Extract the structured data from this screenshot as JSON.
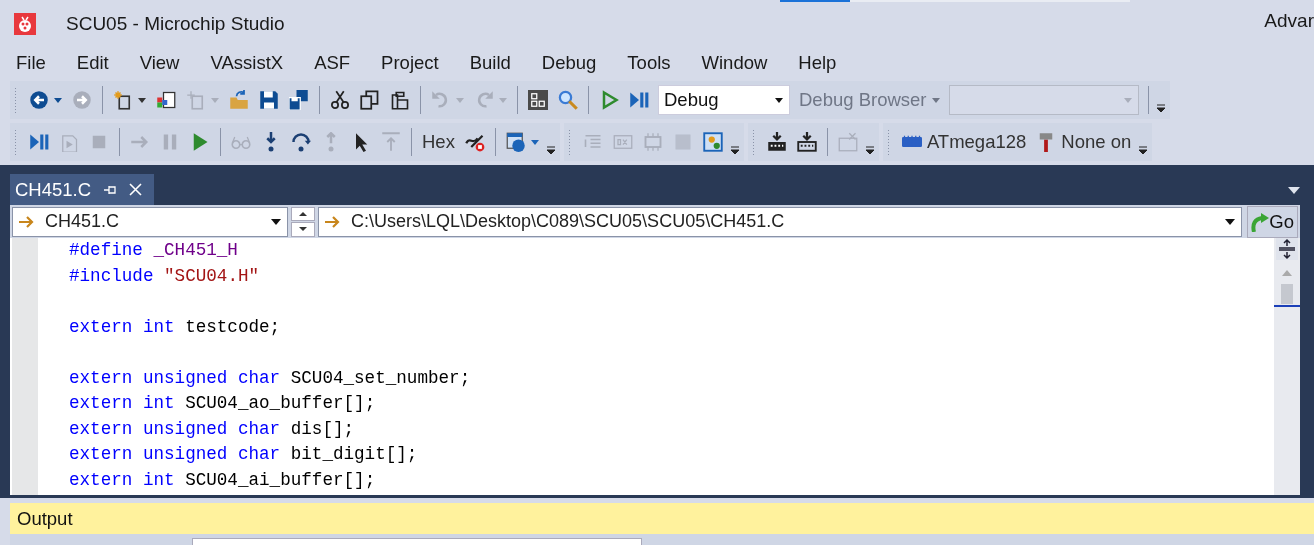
{
  "window": {
    "title": "SCU05 - Microchip Studio",
    "title_right": "Advar"
  },
  "menu": [
    "File",
    "Edit",
    "View",
    "VAssistX",
    "ASF",
    "Project",
    "Build",
    "Debug",
    "Tools",
    "Window",
    "Help"
  ],
  "toolbars": [
    {
      "groups": [
        {
          "items": [
            {
              "kind": "button",
              "disabled": false,
              "dropdown": true
            },
            {
              "kind": "button",
              "disabled": true,
              "dropdown": false
            },
            {
              "kind": "separator"
            },
            {
              "kind": "button",
              "disabled": false,
              "dropdown": true
            },
            {
              "kind": "button",
              "disabled": false,
              "dropdown": false
            },
            {
              "kind": "button",
              "disabled": true,
              "dropdown": true
            },
            {
              "kind": "button",
              "disabled": false,
              "dropdown": false
            },
            {
              "kind": "button",
              "disabled": false,
              "dropdown": false
            },
            {
              "kind": "button",
              "disabled": false,
              "dropdown": false
            },
            {
              "kind": "separator"
            },
            {
              "kind": "button",
              "disabled": false,
              "dropdown": false
            },
            {
              "kind": "button",
              "disabled": false,
              "dropdown": false
            },
            {
              "kind": "button",
              "disabled": false,
              "dropdown": false
            },
            {
              "kind": "separator"
            },
            {
              "kind": "button",
              "disabled": true,
              "dropdown": true
            },
            {
              "kind": "button",
              "disabled": true,
              "dropdown": true
            },
            {
              "kind": "separator"
            },
            {
              "kind": "button",
              "disabled": false,
              "dropdown": false
            },
            {
              "kind": "button",
              "disabled": false,
              "dropdown": false
            },
            {
              "kind": "separator"
            },
            {
              "kind": "button",
              "disabled": false,
              "dropdown": false
            },
            {
              "kind": "button",
              "disabled": false,
              "dropdown": false
            },
            {
              "kind": "combo",
              "value": "Debug",
              "disabled": false
            },
            {
              "kind": "text_button",
              "label": "Debug Browser",
              "disabled": true,
              "dropdown": true
            },
            {
              "kind": "combo",
              "disabled": true
            },
            {
              "kind": "separator"
            }
          ]
        }
      ]
    },
    {
      "groups": [
        {
          "items": [
            {
              "kind": "button",
              "disabled": false,
              "dropdown": false
            },
            {
              "kind": "button",
              "disabled": true,
              "dropdown": false
            },
            {
              "kind": "button",
              "disabled": true,
              "dropdown": false
            },
            {
              "kind": "separator"
            },
            {
              "kind": "button",
              "disabled": true,
              "dropdown": false
            },
            {
              "kind": "button",
              "disabled": true,
              "dropdown": false
            },
            {
              "kind": "button",
              "disabled": false,
              "dropdown": false
            },
            {
              "kind": "separator"
            },
            {
              "kind": "button",
              "disabled": true,
              "dropdown": false
            },
            {
              "kind": "button",
              "disabled": false,
              "dropdown": false
            },
            {
              "kind": "button",
              "disabled": false,
              "dropdown": false
            },
            {
              "kind": "button",
              "disabled": true,
              "dropdown": false
            },
            {
              "kind": "button",
              "disabled": false,
              "dropdown": false
            },
            {
              "kind": "button",
              "disabled": true,
              "dropdown": false
            },
            {
              "kind": "separator"
            },
            {
              "kind": "text_button",
              "label": "Hex",
              "disabled": false,
              "dropdown": false
            },
            {
              "kind": "button",
              "disabled": false,
              "dropdown": false
            },
            {
              "kind": "separator"
            },
            {
              "kind": "button",
              "disabled": false,
              "dropdown": true
            }
          ]
        },
        {
          "items": [
            {
              "kind": "button",
              "disabled": true,
              "dropdown": false
            },
            {
              "kind": "button",
              "disabled": true,
              "dropdown": false
            },
            {
              "kind": "button",
              "disabled": true,
              "dropdown": false
            },
            {
              "kind": "button",
              "disabled": true,
              "dropdown": false
            },
            {
              "kind": "button",
              "disabled": false,
              "dropdown": false
            }
          ]
        },
        {
          "items": [
            {
              "kind": "button",
              "disabled": false,
              "dropdown": false
            },
            {
              "kind": "button",
              "disabled": false,
              "dropdown": false
            },
            {
              "kind": "separator"
            },
            {
              "kind": "button",
              "disabled": true,
              "dropdown": false
            }
          ]
        },
        {
          "items": [
            {
              "kind": "icon_text_button",
              "label": "ATmega128",
              "disabled": false,
              "dropdown": false
            },
            {
              "kind": "icon_text_button",
              "label": "None on",
              "disabled": false,
              "dropdown": false
            }
          ]
        }
      ]
    }
  ],
  "editor": {
    "tabs": [
      {
        "label": "CH451.C",
        "selected": true
      }
    ],
    "nav": {
      "file": "CH451.C",
      "path": "C:\\Users\\LQL\\Desktop\\C089\\SCU05\\SCU05\\CH451.C",
      "go": "Go"
    },
    "lines": [
      {
        "kind": "code",
        "tokens": [
          {
            "kind": "keyword",
            "text": "#define "
          },
          {
            "kind": "macro",
            "text": "_CH451_H"
          }
        ]
      },
      {
        "kind": "code",
        "tokens": [
          {
            "kind": "keyword",
            "text": "#include "
          },
          {
            "kind": "string",
            "text": "\"SCU04.H\""
          }
        ]
      },
      {
        "kind": "blank"
      },
      {
        "kind": "code",
        "tokens": [
          {
            "kind": "keyword",
            "text": "extern int "
          },
          {
            "kind": "plain",
            "text": "testcode;"
          }
        ]
      },
      {
        "kind": "blank"
      },
      {
        "kind": "code",
        "tokens": [
          {
            "kind": "keyword",
            "text": "extern unsigned char "
          },
          {
            "kind": "plain",
            "text": "SCU04_set_number;"
          }
        ]
      },
      {
        "kind": "code",
        "tokens": [
          {
            "kind": "keyword",
            "text": "extern int "
          },
          {
            "kind": "plain",
            "text": "SCU04_ao_buffer[];"
          }
        ]
      },
      {
        "kind": "code",
        "tokens": [
          {
            "kind": "keyword",
            "text": "extern unsigned char "
          },
          {
            "kind": "plain",
            "text": "dis[];"
          }
        ]
      },
      {
        "kind": "code",
        "tokens": [
          {
            "kind": "keyword",
            "text": "extern unsigned char "
          },
          {
            "kind": "plain",
            "text": "bit_digit[];"
          }
        ]
      },
      {
        "kind": "code",
        "tokens": [
          {
            "kind": "keyword",
            "text": "extern int "
          },
          {
            "kind": "plain",
            "text": "SCU04_ai_buffer[];"
          }
        ]
      }
    ]
  },
  "output": {
    "title": "Output"
  }
}
